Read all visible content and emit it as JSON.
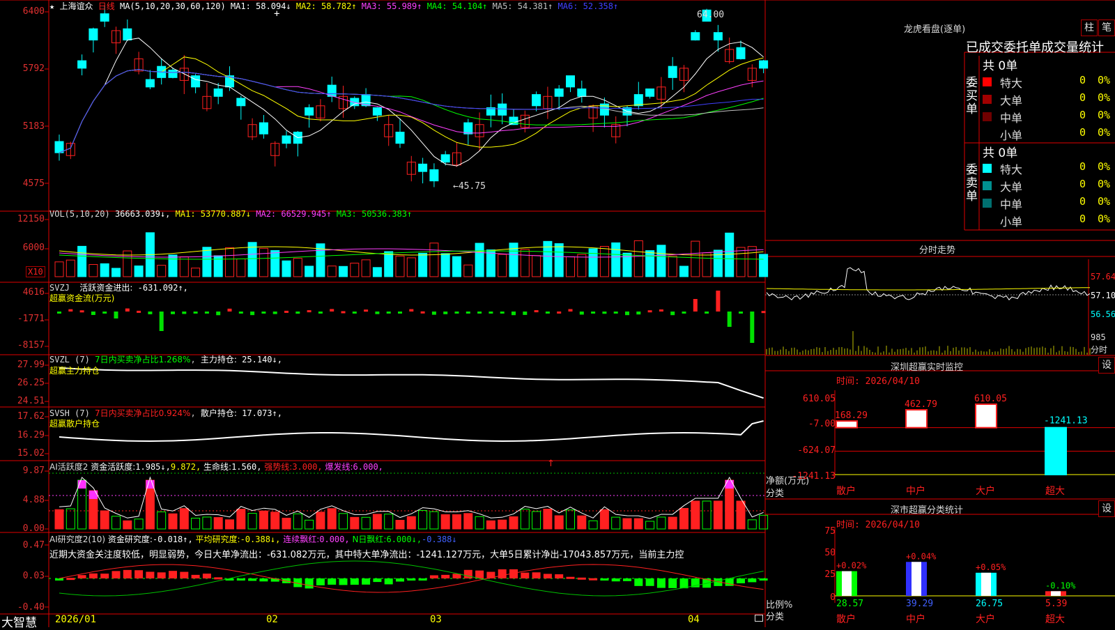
{
  "colors": {
    "up": "#ff2020",
    "down": "#00ffff",
    "grid": "#b00000",
    "text": "#c0c0c0",
    "yellow": "#ffff00"
  },
  "app": {
    "brand": "大智慧",
    "stock_name": "上海谊众",
    "period": "日线",
    "star": "★"
  },
  "kline": {
    "ma_header": "MA(5,10,20,30,60,120)",
    "ma_items": [
      {
        "label": "MA1:",
        "value": "58.094↓",
        "color": "#ffffff"
      },
      {
        "label": "MA2:",
        "value": "58.782↑",
        "color": "#ffff00"
      },
      {
        "label": "MA3:",
        "value": "55.989↑",
        "color": "#ff40ff"
      },
      {
        "label": "MA4:",
        "value": "54.104↑",
        "color": "#00ff00"
      },
      {
        "label": "MA5:",
        "value": "54.381↑",
        "color": "#c0c0c0"
      },
      {
        "label": "MA6:",
        "value": "52.358↑",
        "color": "#4040ff"
      }
    ],
    "y_labels": [
      "6400",
      "5792",
      "5183",
      "4575"
    ],
    "high_note": "64.00",
    "low_note": "←45.75",
    "cursor_mark": "+"
  },
  "vol": {
    "header": "VOL(5,10,20)",
    "value": "36663.039↓,",
    "items": [
      {
        "label": "MA1:",
        "value": "53770.887↓",
        "color": "#ffff00"
      },
      {
        "label": "MA2:",
        "value": "66529.945↑",
        "color": "#ff40ff"
      },
      {
        "label": "MA3:",
        "value": "50536.383↑",
        "color": "#00ff00"
      }
    ],
    "y_labels": [
      "12150",
      "6000"
    ],
    "unit": "X10"
  },
  "svzj": {
    "header": "SVZJ",
    "label": "活跃资金进出:",
    "value": "-631.092↑,",
    "sub": "超赢资金流(万元)",
    "y_labels": [
      "4616",
      "-1771",
      "-8157"
    ]
  },
  "svzl": {
    "header": "SVZL (7)",
    "label1": "7日内买卖净占比1.268%",
    "label2": "主力持仓:",
    "value2": "25.140↓,",
    "sub": "超赢主力持仓",
    "y_labels": [
      "27.99",
      "26.25",
      "24.51"
    ]
  },
  "svsh": {
    "header": "SVSH (7)",
    "label1": "7日内买卖净占比0.924%",
    "label2": "散户持仓:",
    "value2": "17.073↑,",
    "sub": "超赢散户持仓",
    "y_labels": [
      "17.62",
      "16.29",
      "15.02"
    ]
  },
  "ai1": {
    "header": "AI活跃度2",
    "label1": "资金活跃度:",
    "v1": "1.985↓,",
    "v2": "9.872,",
    "label3": "生命线:",
    "v3": "1.560,",
    "label4": "强势线:",
    "v4": "3.000,",
    "label5": "爆发线:",
    "v5": "6.000,",
    "arrow": "↑",
    "y_labels": [
      "9.87",
      "4.88",
      "0.00"
    ]
  },
  "ai2": {
    "header": "AI研究度2(10)",
    "label1": "资金研究度:",
    "v1": "-0.018↑,",
    "label2": "平均研究度:",
    "v2": "-0.388↓,",
    "label3": "连续飘红:",
    "v3": "0.000,",
    "label4": "N日飘红:",
    "v4": "6.000↓,",
    "v5": "-0.388↓",
    "comment": "近期大资金关注度较低，明显弱势，今日大单净流出：-631.082万元，其中特大单净流出：-1241.127万元，大单5日累计净出-17043.857万元，当前主力控",
    "y_labels": [
      "0.47",
      "0.03",
      "-0.40"
    ]
  },
  "dates": [
    "2026/01",
    "02",
    "03",
    "04"
  ],
  "right": {
    "lhb_title": "龙虎看盘(逐单)",
    "btn1": "柱",
    "btn2": "笔",
    "stat_title": "已成交委托单成交量统计",
    "buy_label": "委买单",
    "sell_label": "委卖单",
    "buy_total": "共 0单",
    "sell_total": "共 0单",
    "buy_rows": [
      {
        "name": "特大",
        "count": "0",
        "pct": "0%",
        "color": "#ff0000"
      },
      {
        "name": "大单",
        "count": "0",
        "pct": "0%",
        "color": "#a00000"
      },
      {
        "name": "中单",
        "count": "0",
        "pct": "0%",
        "color": "#700000"
      },
      {
        "name": "小单",
        "count": "0",
        "pct": "0%",
        "color": ""
      }
    ],
    "sell_rows": [
      {
        "name": "特大",
        "count": "0",
        "pct": "0%",
        "color": "#00ffff"
      },
      {
        "name": "大单",
        "count": "0",
        "pct": "0%",
        "color": "#009090"
      },
      {
        "name": "中单",
        "count": "0",
        "pct": "0%",
        "color": "#007070"
      },
      {
        "name": "小单",
        "count": "0",
        "pct": "0%",
        "color": ""
      }
    ],
    "intraday_title": "分时走势",
    "intraday_y": [
      "57.64",
      "57.10",
      "56.56"
    ],
    "intraday_vol": "985",
    "intraday_vol_unit": "分时",
    "monitor_title": "深圳超赢实时监控",
    "monitor_time": "时间: 2026/04/10",
    "monitor_btn": "设",
    "monitor_y": [
      "610.05",
      "-7.00",
      "-624.07",
      "-1241.13"
    ],
    "monitor_ylabel": "净额(万元)",
    "monitor_xlabel": "分类",
    "class_title": "深市超赢分类统计",
    "class_time": "时间: 2026/04/10",
    "class_btn": "设",
    "class_y": [
      "75",
      "50",
      "25",
      "0"
    ],
    "class_ylabel": "比例%",
    "class_xlabel": "分类"
  },
  "chart_data": [
    {
      "type": "bar",
      "title": "深圳超赢实时监控",
      "ylabel": "净额(万元)",
      "categories": [
        "散户",
        "中户",
        "大户",
        "超大"
      ],
      "values": [
        168.29,
        462.79,
        610.05,
        -1241.13
      ],
      "ylim": [
        -1241.13,
        610.05
      ]
    },
    {
      "type": "bar",
      "title": "深市超赢分类统计",
      "ylabel": "比例%",
      "categories": [
        "散户",
        "中户",
        "大户",
        "超大"
      ],
      "values": [
        28.57,
        39.29,
        26.75,
        5.39
      ],
      "changes": [
        "+0.02%",
        "+0.04%",
        "+0.05%",
        "-0.10%"
      ],
      "ylim": [
        0,
        75
      ]
    },
    {
      "type": "line",
      "title": "日线",
      "series": [
        {
          "name": "MA1",
          "values": []
        }
      ],
      "ylim": [
        45.75,
        64.0
      ]
    }
  ]
}
